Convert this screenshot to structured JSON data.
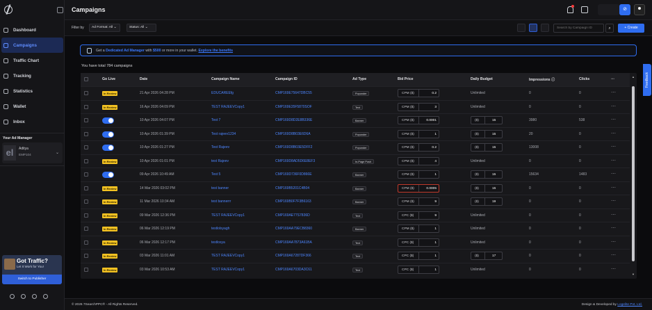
{
  "sidebar": {
    "nav": [
      {
        "label": "Dashboard",
        "icon": "home-icon",
        "active": false
      },
      {
        "label": "Campaigns",
        "icon": "campaigns-icon",
        "active": true
      },
      {
        "label": "Traffic Chart",
        "icon": "chart-icon",
        "active": false
      },
      {
        "label": "Tracking",
        "icon": "tracking-icon",
        "active": false
      },
      {
        "label": "Statistics",
        "icon": "statistics-icon",
        "active": false
      },
      {
        "label": "Wallet",
        "icon": "wallet-icon",
        "active": false
      },
      {
        "label": "Inbox",
        "icon": "inbox-icon",
        "active": false
      }
    ],
    "manager": {
      "title": "Your Ad Manager",
      "initials": "el",
      "name": "Aditya",
      "id": "EMP104"
    },
    "promo": {
      "title": "Got Traffic?",
      "subtitle": "Let It Work for You!",
      "button": "Switch to Publisher"
    }
  },
  "topbar": {
    "title": "Campaigns"
  },
  "filters": {
    "label": "Filter by",
    "ad_format": "Ad Format: All",
    "status": "Status: All",
    "search_placeholder": "Search by Campaign ID",
    "create_label": "+ Create"
  },
  "banner": {
    "pre": "Get a ",
    "bold": "Dedicated Ad Manager",
    "mid": " with ",
    "amount": "$500",
    "post": " or more in your wallet. ",
    "link": "Explore the benefits"
  },
  "total_text": "You have total 784 campaigns",
  "table": {
    "headers": [
      "Go Live",
      "Date",
      "Campaign Name",
      "Campaign ID",
      "Ad Type",
      "Bid Price",
      "Daily Budget",
      "Impressions ⓘ",
      "Clicks"
    ],
    "rows": [
      {
        "live": "review",
        "date": "21 Apr 2026 04:28 PM",
        "name": "EDUCAREEfg",
        "id": "CMP169E75647DBC55",
        "adtype": "Popunder",
        "bid_label": "CPM ($)",
        "bid": "0.2",
        "bid_hl": false,
        "budget": "Unlimited",
        "budget_box": false,
        "impressions": "0",
        "clicks": "0"
      },
      {
        "live": "review",
        "date": "16 Apr 2026 04:09 PM",
        "name": "TEST RAJEEVCopy1",
        "id": "CMP169E35F5870SOF",
        "adtype": "Text",
        "bid_label": "CPM ($)",
        "bid": "3",
        "bid_hl": false,
        "budget": "Unlimited",
        "budget_box": false,
        "impressions": "0",
        "clicks": "0"
      },
      {
        "live": "on",
        "date": "10 Apr 2026 04:07 PM",
        "name": "Test 7",
        "id": "CMP169D8D2E8B336E",
        "adtype": "Banner",
        "bid_label": "CPM ($)",
        "bid": "0.0001",
        "bid_hl": false,
        "budget": "15",
        "budget_box": true,
        "impressions": "3980",
        "clicks": "538"
      },
      {
        "live": "on",
        "date": "10 Apr 2026 01:39 PM",
        "name": "Test rajeev1234",
        "id": "CMP169D8B03E6D6A",
        "adtype": "Popunder",
        "bid_label": "CPM ($)",
        "bid": "1",
        "bid_hl": false,
        "budget": "15",
        "budget_box": true,
        "impressions": "20",
        "clicks": "0"
      },
      {
        "live": "on",
        "date": "10 Apr 2026 01:27 PM",
        "name": "Test Rajeev",
        "id": "CMP169D8B03E5DFF2",
        "adtype": "Popunder",
        "bid_label": "CPM ($)",
        "bid": "0.2",
        "bid_hl": false,
        "budget": "15",
        "budget_box": true,
        "impressions": "13008",
        "clicks": "0"
      },
      {
        "live": "review",
        "date": "10 Apr 2026 01:01 PM",
        "name": "test Rajeev",
        "id": "CMP169D8AD5D6E8EF3",
        "adtype": "In-Page Push",
        "bid_label": "CPM ($)",
        "bid": "4",
        "bid_hl": false,
        "budget": "Unlimited",
        "budget_box": false,
        "impressions": "0",
        "clicks": "0"
      },
      {
        "live": "on",
        "date": "09 Apr 2026 10:49 AM",
        "name": "Test 5",
        "id": "CMP169D736F0D866E",
        "adtype": "Banner",
        "bid_label": "CPM ($)",
        "bid": "1",
        "bid_hl": false,
        "budget": "15",
        "budget_box": true,
        "impressions": "15634",
        "clicks": "1483"
      },
      {
        "live": "review",
        "date": "14 Mar 2026 03:02 PM",
        "name": "test banner",
        "id": "CMP169B5201C4B04",
        "adtype": "Banner",
        "bid_label": "CPM ($)",
        "bid": "0.0005",
        "bid_hl": true,
        "budget": "15",
        "budget_box": true,
        "impressions": "0",
        "clicks": "0"
      },
      {
        "live": "review",
        "date": "11 Mar 2026 10:34 AM",
        "name": "test bannerrr",
        "id": "CMP169B0F7F3B6163",
        "adtype": "Banner",
        "bid_label": "CPM ($)",
        "bid": "9",
        "bid_hl": false,
        "budget": "19",
        "budget_box": true,
        "impressions": "0",
        "clicks": "0"
      },
      {
        "live": "review",
        "date": "09 Mar 2026 12:36 PM",
        "name": "TEST RAJEEVCopy1",
        "id": "CMP169AE77S7836D",
        "adtype": "Text",
        "bid_label": "CPC ($)",
        "bid": "9",
        "bid_hl": false,
        "budget": "Unlimited",
        "budget_box": false,
        "impressions": "0",
        "clicks": "0"
      },
      {
        "live": "review",
        "date": "06 Mar 2026 12:19 PM",
        "name": "testlolsyagh",
        "id": "CMP169AA79ECB8360",
        "adtype": "Banner",
        "bid_label": "CPM ($)",
        "bid": "1",
        "bid_hl": false,
        "budget": "Unlimited",
        "budget_box": false,
        "impressions": "0",
        "clicks": "0"
      },
      {
        "live": "review",
        "date": "06 Mar 2026 12:17 PM",
        "name": "testlosya",
        "id": "CMP169AA7873A61BA",
        "adtype": "Text",
        "bid_label": "CPC ($)",
        "bid": "1",
        "bid_hl": false,
        "budget": "Unlimited",
        "budget_box": false,
        "impressions": "0",
        "clicks": "0"
      },
      {
        "live": "review",
        "date": "03 Mar 2026 11:01 AM",
        "name": "TEST RAJEEVCopy1",
        "id": "CMP169A67287DF366",
        "adtype": "Text",
        "bid_label": "CPC ($)",
        "bid": "1",
        "bid_hl": false,
        "budget": "17",
        "budget_box": true,
        "impressions": "0",
        "clicks": "0"
      },
      {
        "live": "review",
        "date": "03 Mar 2026 10:53 AM",
        "name": "TEST RAJEEVCopy1",
        "id": "CMP169A6703DA3C61",
        "adtype": "Text",
        "bid_label": "CPC ($)",
        "bid": "1",
        "bid_hl": false,
        "budget": "Unlimited",
        "budget_box": false,
        "impressions": "0",
        "clicks": "0"
      }
    ],
    "review_label": "In Review",
    "budget_currency": "($)",
    "more": "⋯"
  },
  "feedback": "Feedback",
  "footer": {
    "copyright": "© 2026 7SearchPPC® - All Rights Reserved.",
    "designed_pre": "Design & Developed by ",
    "designed_link": "Logelite Pvt. Ltd."
  },
  "colors": {
    "accent": "#2f6df0",
    "review": "#f3c222",
    "link": "#4d86ff"
  }
}
